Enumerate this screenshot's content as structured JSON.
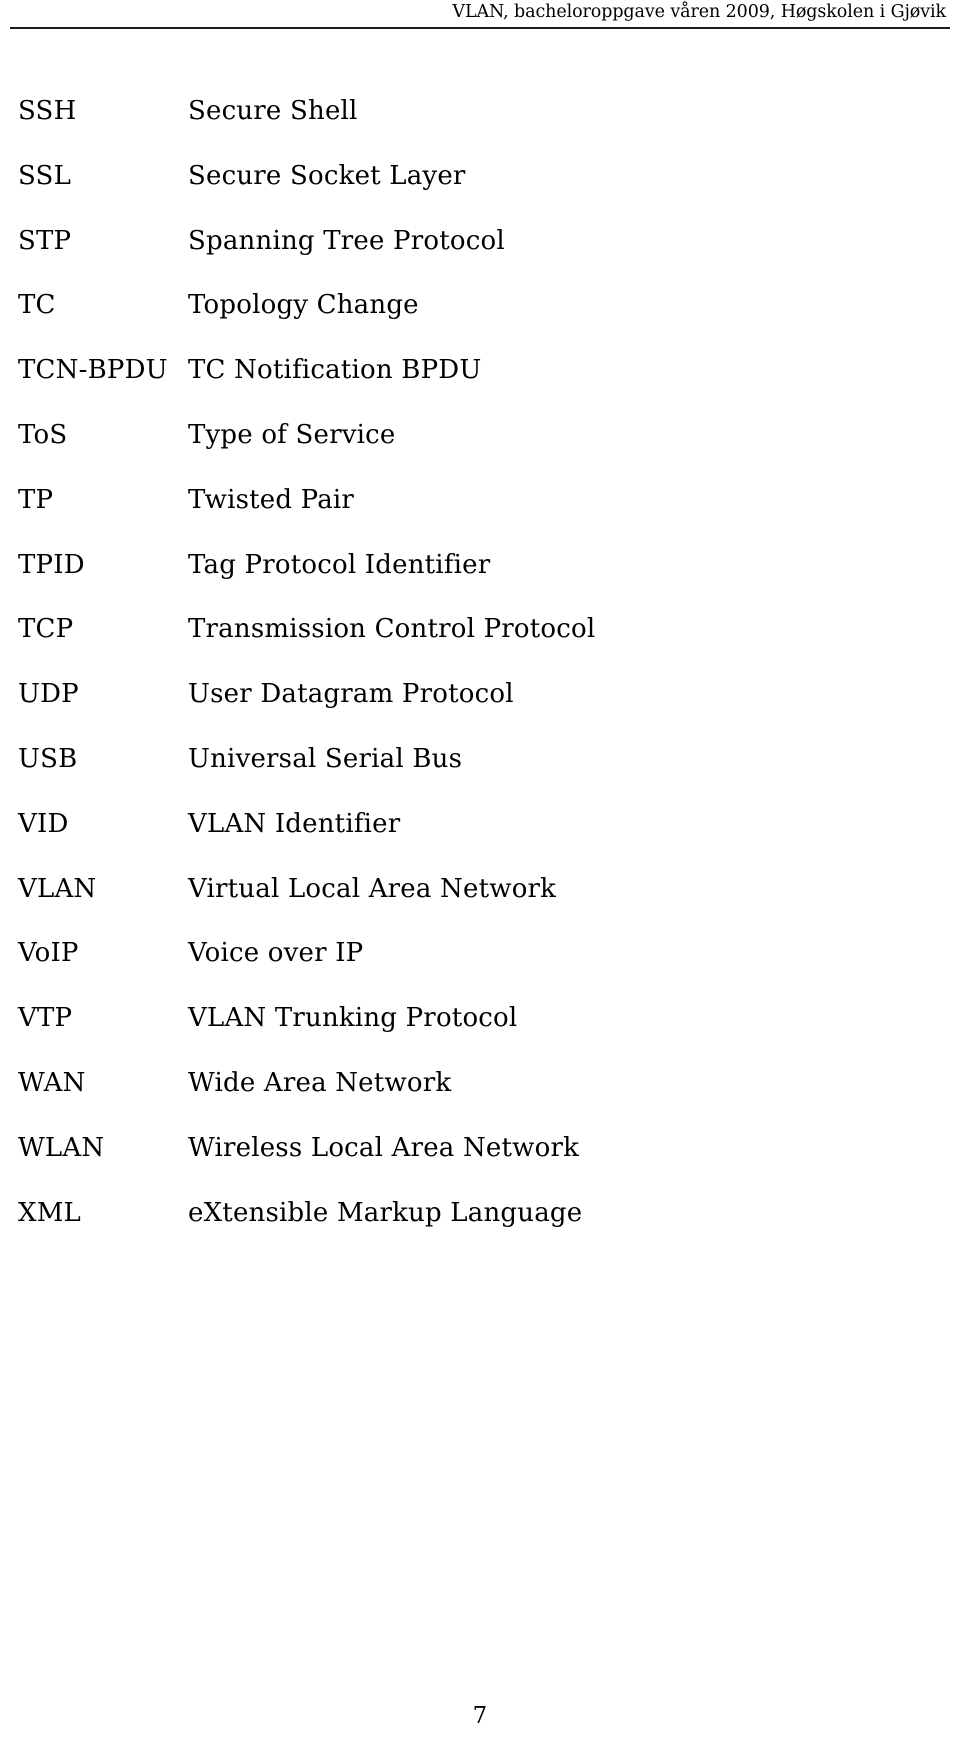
{
  "header": {
    "title": "VLAN, bacheloroppgave våren 2009, Høgskolen i Gjøvik"
  },
  "abbreviations": [
    {
      "term": "SSH",
      "definition": "Secure Shell"
    },
    {
      "term": "SSL",
      "definition": "Secure Socket Layer"
    },
    {
      "term": "STP",
      "definition": "Spanning Tree Protocol"
    },
    {
      "term": "TC",
      "definition": "Topology Change"
    },
    {
      "term": "TCN-BPDU",
      "definition": "TC Notification BPDU"
    },
    {
      "term": "ToS",
      "definition": "Type of Service"
    },
    {
      "term": "TP",
      "definition": "Twisted Pair"
    },
    {
      "term": "TPID",
      "definition": "Tag Protocol Identifier"
    },
    {
      "term": "TCP",
      "definition": "Transmission Control Protocol"
    },
    {
      "term": "UDP",
      "definition": "User Datagram Protocol"
    },
    {
      "term": "USB",
      "definition": "Universal Serial Bus"
    },
    {
      "term": "VID",
      "definition": "VLAN Identifier"
    },
    {
      "term": "VLAN",
      "definition": "Virtual Local Area Network"
    },
    {
      "term": "VoIP",
      "definition": "Voice over IP"
    },
    {
      "term": "VTP",
      "definition": "VLAN Trunking Protocol"
    },
    {
      "term": "WAN",
      "definition": "Wide Area Network"
    },
    {
      "term": "WLAN",
      "definition": "Wireless Local Area Network"
    },
    {
      "term": "XML",
      "definition": "eXtensible Markup Language"
    }
  ],
  "footer": {
    "page_number": "7"
  }
}
